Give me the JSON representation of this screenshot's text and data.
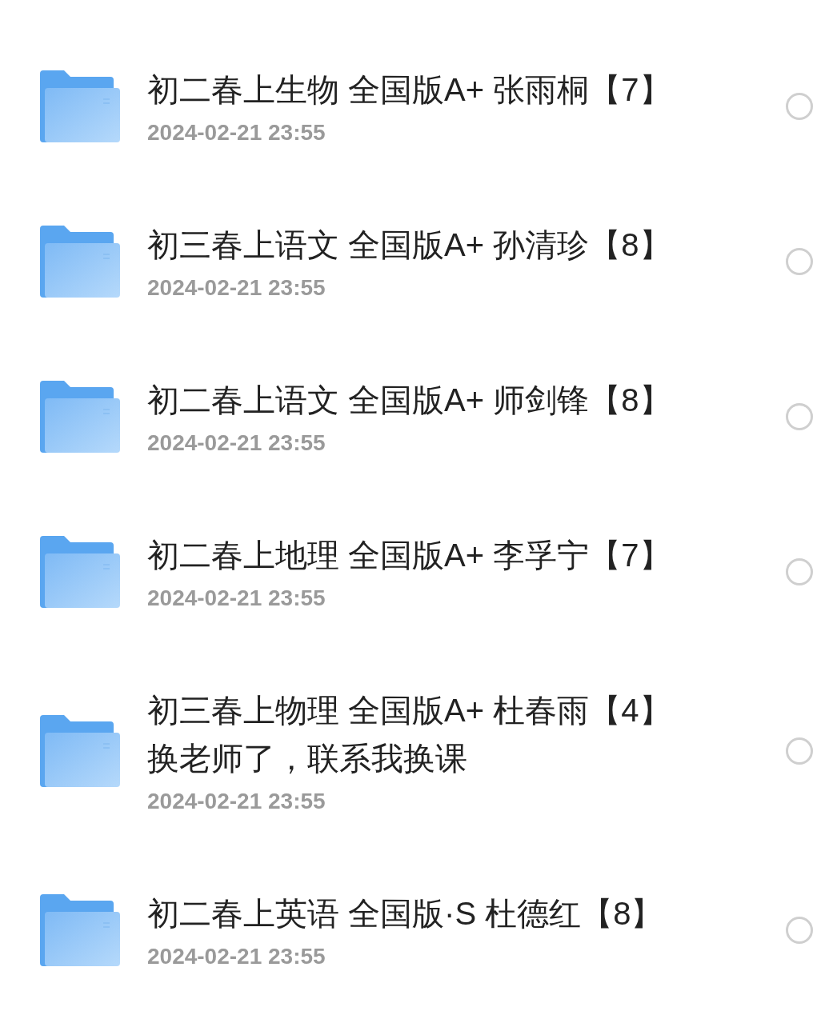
{
  "files": [
    {
      "title": "初二春上生物 全国版A+ 张雨桐【7】",
      "date": "2024-02-21 23:55",
      "selected": false
    },
    {
      "title": "初三春上语文 全国版A+ 孙清珍【8】",
      "date": "2024-02-21 23:55",
      "selected": false
    },
    {
      "title": "初二春上语文 全国版A+ 师剑锋【8】",
      "date": "2024-02-21 23:55",
      "selected": false
    },
    {
      "title": "初二春上地理 全国版A+ 李孚宁【7】",
      "date": "2024-02-21 23:55",
      "selected": false
    },
    {
      "title": "初三春上物理 全国版A+ 杜春雨【4】换老师了，联系我换课",
      "date": "2024-02-21 23:55",
      "selected": false
    },
    {
      "title": "初二春上英语 全国版·S 杜德红【8】",
      "date": "2024-02-21 23:55",
      "selected": false
    }
  ]
}
